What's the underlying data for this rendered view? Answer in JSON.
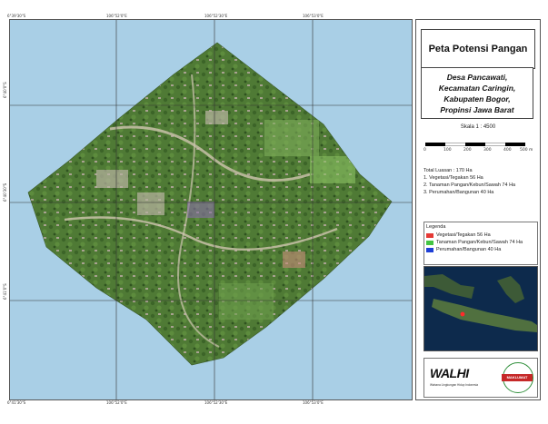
{
  "map": {
    "top_coords": [
      "6°39'30\"S",
      "106°52'0\"E",
      "106°52'30\"E",
      "106°53'0\"E"
    ],
    "bottom_coords": [
      "6°41'30\"S",
      "106°52'0\"E",
      "106°52'30\"E",
      "106°53'0\"E"
    ],
    "left_coords": [
      "6°40'0\"S",
      "6°40'30\"S",
      "6°41'0\"S"
    ]
  },
  "panel": {
    "title": "Peta Potensi Pangan",
    "location_lines": [
      "Desa Pancawati,",
      "Kecamatan Caringin,",
      "Kabupaten Bogor,",
      "Propinsi Jawa Barat"
    ],
    "scale": "Skala 1 : 4500",
    "scale_ticks": [
      "0",
      "100",
      "200",
      "300",
      "400",
      "500 m"
    ],
    "total": "Total Luasan : 170 Ha",
    "items": [
      "1. Vegetasi/Tegakan 56 Ha",
      "2. Tanaman Pangan/Kebun/Sawah 74 Ha",
      "3. Perumahan/Bangunan 40 Ha"
    ],
    "legend_title": "Legenda",
    "legend": [
      {
        "label": "Vegetasi/Tegakan 56 Ha",
        "color": "#e53935"
      },
      {
        "label": "Tanaman Pangan/Kebun/Sawah 74 Ha",
        "color": "#43c443"
      },
      {
        "label": "Perumahan/Bangunan 40 Ha",
        "color": "#1e3fd6"
      }
    ],
    "logo_left": "WALHI",
    "logo_left_sub": "Wahana Lingkungan Hidup Indonesia",
    "logo_right": "MAKLUMAT"
  }
}
